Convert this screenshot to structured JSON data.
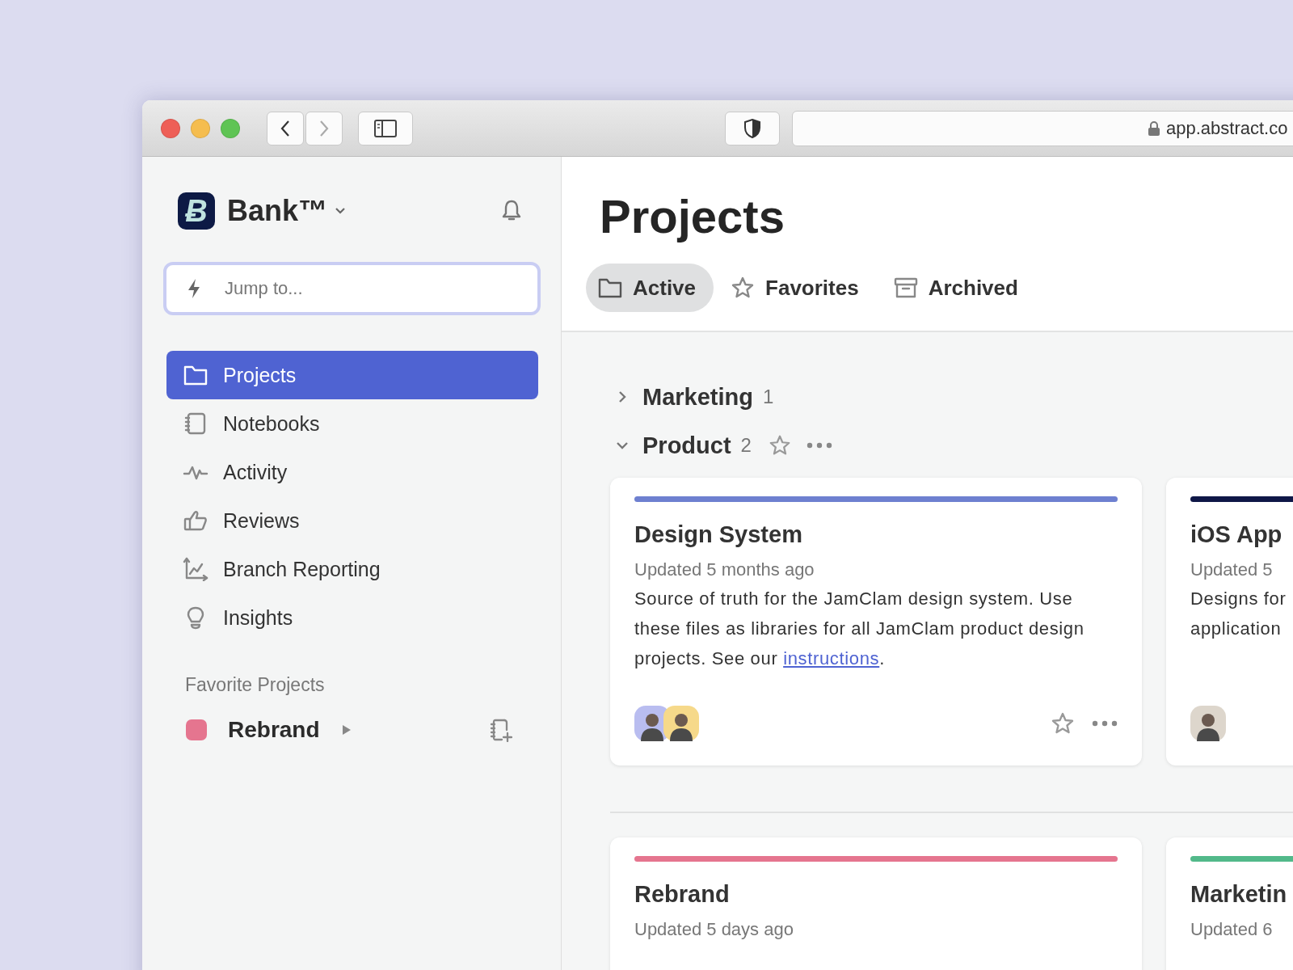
{
  "browser": {
    "url": "app.abstract.co"
  },
  "workspace": {
    "logo": "Ƀ",
    "name": "Bank™"
  },
  "search": {
    "placeholder": "Jump to..."
  },
  "sidebar": {
    "items": [
      {
        "label": "Projects",
        "kind": "folder",
        "selected": true
      },
      {
        "label": "Notebooks",
        "kind": "notebook",
        "selected": false
      },
      {
        "label": "Activity",
        "kind": "pulse",
        "selected": false
      },
      {
        "label": "Reviews",
        "kind": "thumb",
        "selected": false
      },
      {
        "label": "Branch Reporting",
        "kind": "chart",
        "selected": false
      },
      {
        "label": "Insights",
        "kind": "bulb",
        "selected": false
      }
    ],
    "favorites_title": "Favorite Projects",
    "favorites": [
      {
        "name": "Rebrand",
        "color": "#e5758f"
      }
    ]
  },
  "page": {
    "title": "Projects"
  },
  "tabs": [
    {
      "label": "Active",
      "kind": "folder",
      "selected": true
    },
    {
      "label": "Favorites",
      "kind": "star",
      "selected": false
    },
    {
      "label": "Archived",
      "kind": "archive",
      "selected": false
    }
  ],
  "groups": [
    {
      "name": "Marketing",
      "count": "1",
      "expanded": false
    },
    {
      "name": "Product",
      "count": "2",
      "expanded": true,
      "cards": [
        {
          "title": "Design System",
          "color": "#6e80d0",
          "updated": "Updated 5 months ago",
          "description": "Source of truth for the JamClam design system. Use these files as libraries for all JamClam product design projects. See our ",
          "link": "instructions",
          "after_link": ".",
          "avatars": [
            {
              "color": "#b9bdf0"
            },
            {
              "color": "#f6d98a"
            }
          ],
          "actions": true
        },
        {
          "title": "iOS App",
          "color": "#0f1747",
          "updated": "Updated 5",
          "description": "Designs for\napplication",
          "avatars": [
            {
              "color": "#ddd6cc"
            }
          ]
        }
      ]
    }
  ],
  "more_cards": [
    {
      "title": "Rebrand",
      "color": "#e5758f",
      "updated": "Updated 5 days ago"
    },
    {
      "title": "Marketin",
      "color": "#52b98a",
      "updated": "Updated 6"
    }
  ]
}
